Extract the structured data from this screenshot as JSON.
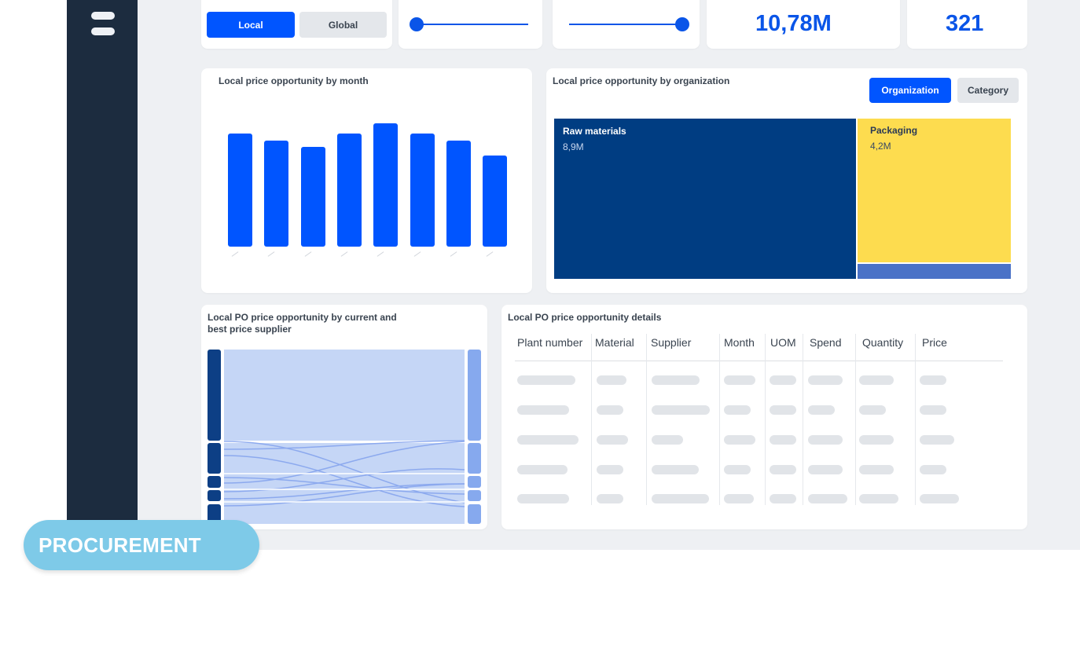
{
  "filters": {
    "scope_local_label": "Local",
    "scope_global_label": "Global"
  },
  "kpis": {
    "kpi1_value": "10,78M",
    "kpi2_value": "321"
  },
  "chart_month": {
    "title": "Local price opportunity by month"
  },
  "chart_data": {
    "type": "bar",
    "title": "Local price opportunity by month",
    "categories": [
      "",
      "",
      "",
      "",
      "",
      "",
      "",
      ""
    ],
    "values": [
      0.92,
      0.86,
      0.81,
      0.92,
      1.0,
      0.92,
      0.86,
      0.74
    ],
    "ylim": [
      0,
      1
    ],
    "grid": false
  },
  "treemap": {
    "title": "Local price opportunity by organization",
    "toggle_organization": "Organization",
    "toggle_category": "Category",
    "items": [
      {
        "label": "Raw materials",
        "value": "8,9M",
        "color": "#003d82"
      },
      {
        "label": "Packaging",
        "value": "4,2M",
        "color": "#fddc4f"
      }
    ],
    "small_segment_color": "#4a72c7"
  },
  "sankey": {
    "title_line1": "Local PO price opportunity by current and",
    "title_line2": "best price supplier",
    "left_color": "#0d3f85",
    "right_color": "#86a9ee",
    "flow_color": "#c5d6f6"
  },
  "details": {
    "title": "Local PO price opportunity details",
    "columns": [
      "Plant number",
      "Material",
      "Supplier",
      "Month",
      "UOM",
      "Spend",
      "Quantity",
      "Price"
    ]
  },
  "badge": {
    "label": "PROCUREMENT"
  },
  "colors": {
    "accent": "#0055ff",
    "sidebar": "#1c2c3f",
    "badge": "#7ecae8"
  }
}
